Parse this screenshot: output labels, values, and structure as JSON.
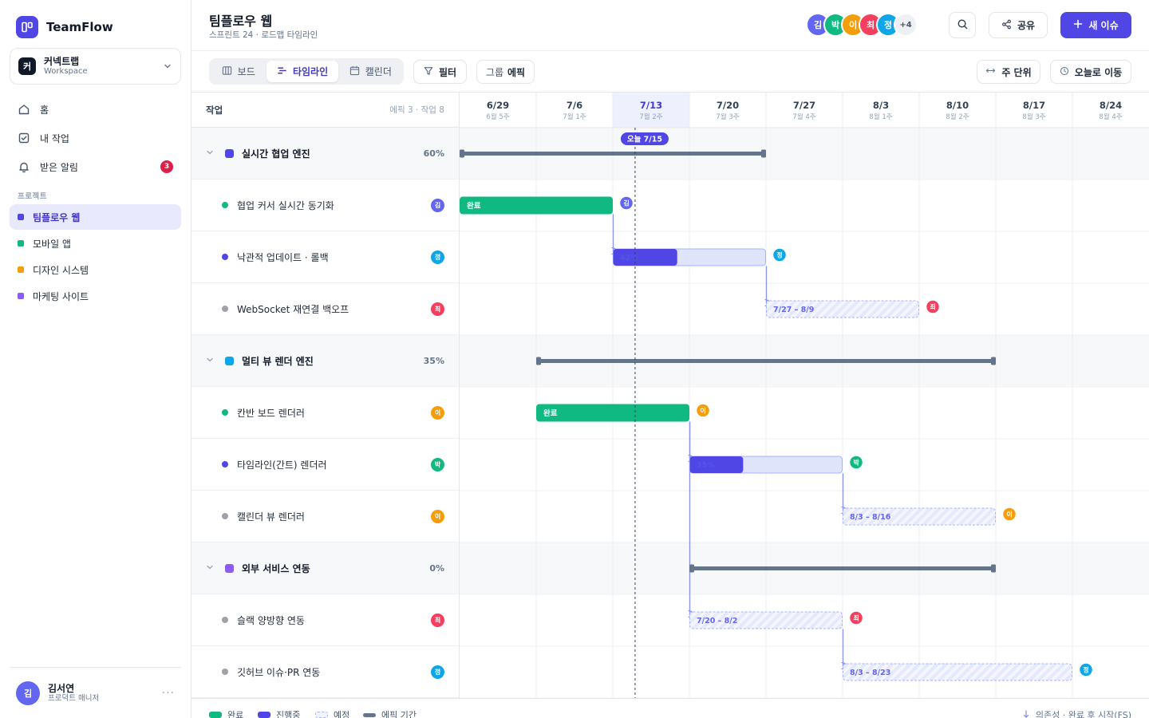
{
  "app": {
    "name": "TeamFlow"
  },
  "workspace": {
    "badge": "커",
    "name": "커넥트랩",
    "sub": "Workspace"
  },
  "nav": [
    {
      "label": "홈",
      "icon": "home-icon"
    },
    {
      "label": "내 작업",
      "icon": "checkbox-icon"
    },
    {
      "label": "받은 알림",
      "icon": "bell-icon",
      "badge": "3"
    }
  ],
  "projects_label": "프로젝트",
  "projects": [
    {
      "label": "팀플로우 웹",
      "color": "#4f46e5",
      "active": true
    },
    {
      "label": "모바일 앱",
      "color": "#10b981",
      "active": false
    },
    {
      "label": "디자인 시스템",
      "color": "#f59e0b",
      "active": false
    },
    {
      "label": "마케팅 사이트",
      "color": "#8b5cf6",
      "active": false
    }
  ],
  "user": {
    "initial": "김",
    "name": "김서연",
    "role": "프로덕트 매니저",
    "more": "···"
  },
  "header": {
    "title": "팀플로우 웹",
    "subtitle": "스프린트 24 · 로드맵 타임라인",
    "members": [
      {
        "initial": "김",
        "color": "#6366f1"
      },
      {
        "initial": "박",
        "color": "#10b981"
      },
      {
        "initial": "이",
        "color": "#f59e0b"
      },
      {
        "initial": "최",
        "color": "#f43f5e"
      },
      {
        "initial": "정",
        "color": "#0ea5e9"
      }
    ],
    "members_more": "+4",
    "share_label": "공유",
    "new_issue_label": "새 이슈"
  },
  "toolbar": {
    "views": [
      {
        "label": "보드",
        "icon": "board-icon",
        "active": false
      },
      {
        "label": "타임라인",
        "icon": "timeline-icon",
        "active": true
      },
      {
        "label": "캘린더",
        "icon": "calendar-icon",
        "active": false
      }
    ],
    "filter_label": "필터",
    "group_label": "그룹",
    "group_value": "에픽",
    "scale_label": "주 단위",
    "today_label": "오늘로 이동"
  },
  "list_header": {
    "title": "작업",
    "count": "에픽 3 · 작업 8"
  },
  "weeks": [
    {
      "date": "6/29",
      "sub": "6월 5주"
    },
    {
      "date": "7/6",
      "sub": "7월 1주"
    },
    {
      "date": "7/13",
      "sub": "7월 2주",
      "current": true
    },
    {
      "date": "7/20",
      "sub": "7월 3주"
    },
    {
      "date": "7/27",
      "sub": "7월 4주"
    },
    {
      "date": "8/3",
      "sub": "8월 1주"
    },
    {
      "date": "8/10",
      "sub": "8월 2주"
    },
    {
      "date": "8/17",
      "sub": "8월 3주"
    },
    {
      "date": "8/24",
      "sub": "8월 4주"
    }
  ],
  "today_label": "오늘 7/15",
  "today_day": 16,
  "rows": [
    {
      "type": "epic",
      "name": "실시간 협업 엔진",
      "pct": "60%",
      "color": "#4f46e5",
      "start": 0,
      "end": 28
    },
    {
      "type": "task",
      "name": "협업 커서 실시간 동기화",
      "status": "done",
      "assignee": "김",
      "avatar_color": "#6366f1",
      "start": 0,
      "end": 14,
      "label": "완료"
    },
    {
      "type": "task",
      "name": "낙관적 업데이트 · 롤백",
      "status": "progress",
      "assignee": "정",
      "avatar_color": "#0ea5e9",
      "start": 14,
      "end": 28,
      "progress": 0.42,
      "label": "42%"
    },
    {
      "type": "task",
      "name": "WebSocket 재연결 백오프",
      "status": "planned",
      "assignee": "최",
      "avatar_color": "#f43f5e",
      "start": 28,
      "end": 42,
      "label": "7/27 – 8/9"
    },
    {
      "type": "epic",
      "name": "멀티 뷰 렌더 엔진",
      "pct": "35%",
      "color": "#0ea5e9",
      "start": 7,
      "end": 49
    },
    {
      "type": "task",
      "name": "칸반 보드 렌더러",
      "status": "done",
      "assignee": "이",
      "avatar_color": "#f59e0b",
      "start": 7,
      "end": 21,
      "label": "완료"
    },
    {
      "type": "task",
      "name": "타임라인(간트) 렌더러",
      "status": "progress",
      "assignee": "박",
      "avatar_color": "#10b981",
      "start": 21,
      "end": 35,
      "progress": 0.35,
      "label": "35%"
    },
    {
      "type": "task",
      "name": "캘린더 뷰 렌더러",
      "status": "planned",
      "assignee": "이",
      "avatar_color": "#f59e0b",
      "start": 35,
      "end": 49,
      "label": "8/3 – 8/16"
    },
    {
      "type": "epic",
      "name": "외부 서비스 연동",
      "pct": "0%",
      "color": "#8b5cf6",
      "start": 21,
      "end": 49
    },
    {
      "type": "task",
      "name": "슬랙 양방향 연동",
      "status": "planned",
      "assignee": "최",
      "avatar_color": "#f43f5e",
      "start": 21,
      "end": 35,
      "label": "7/20 – 8/2"
    },
    {
      "type": "task",
      "name": "깃허브 이슈·PR 연동",
      "status": "planned",
      "assignee": "정",
      "avatar_color": "#0ea5e9",
      "start": 35,
      "end": 56,
      "label": "8/3 – 8/23"
    }
  ],
  "dependencies": [
    {
      "from": 1,
      "to": 2
    },
    {
      "from": 2,
      "to": 3
    },
    {
      "from": 5,
      "to": 6
    },
    {
      "from": 6,
      "to": 7
    },
    {
      "from": 5,
      "to": 9
    },
    {
      "from": 9,
      "to": 10
    }
  ],
  "legend": [
    {
      "label": "완료",
      "kind": "done"
    },
    {
      "label": "진행중",
      "kind": "progress"
    },
    {
      "label": "예정",
      "kind": "planned"
    },
    {
      "label": "에픽 기간",
      "kind": "epic"
    }
  ],
  "dependency_note": "의존성 · 완료 후 시작(FS)",
  "colors": {
    "accent": "#4f46e5",
    "done": "#10b981",
    "progress": "#4f46e5",
    "progress_track": "#e0e4fb",
    "planned": "#a5b4fc",
    "epic_bar": "#64748b",
    "today": "#4f46e5"
  }
}
